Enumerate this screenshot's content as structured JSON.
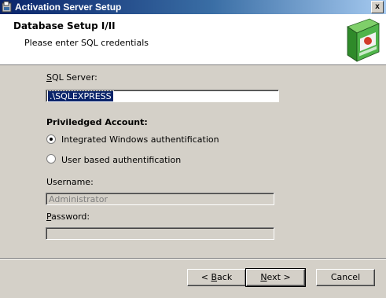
{
  "window": {
    "title": "Activation Server Setup",
    "close_label": "x"
  },
  "header": {
    "title": "Database Setup I/II",
    "subtitle": "Please enter SQL credentials"
  },
  "form": {
    "sql_server_label_prefix": "",
    "sql_server_label_hotkey": "S",
    "sql_server_label_rest": "QL Server:",
    "sql_server_value": ".\\SQLEXPRESS",
    "account_heading": "Priviledged Account:",
    "radio_windows_label": "Integrated Windows authentification",
    "radio_windows_selected": true,
    "radio_user_label": "User based authentification",
    "radio_user_selected": false,
    "username_label": "Username:",
    "username_value": "Administrator",
    "password_label_hotkey": "P",
    "password_label_rest": "assword:",
    "password_value": ""
  },
  "buttons": {
    "back_prefix": "< ",
    "back_hotkey": "B",
    "back_rest": "ack",
    "next_hotkey": "N",
    "next_rest": "ext >",
    "cancel": "Cancel"
  },
  "colors": {
    "title_gradient_start": "#0a246a",
    "title_gradient_end": "#a6caf0",
    "dialog_bg": "#d4d0c8",
    "selection": "#0a246a"
  }
}
